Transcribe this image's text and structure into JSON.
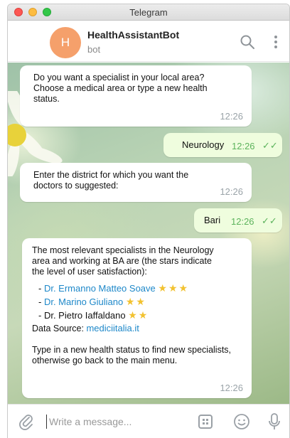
{
  "window": {
    "title": "Telegram"
  },
  "chat": {
    "avatar_letter": "H",
    "name": "HealthAssistantBot",
    "status": "bot"
  },
  "messages": [
    {
      "dir": "in",
      "lines": [
        "Do you want a specialist in your local area?",
        "Choose a medical area or type a new health",
        "status."
      ],
      "time": "12:26"
    },
    {
      "dir": "out",
      "text": "Neurology",
      "time": "12:26",
      "ticks": "✓✓"
    },
    {
      "dir": "in",
      "lines": [
        "Enter the district for which you want the",
        "doctors to suggested:"
      ],
      "time": "12:26"
    },
    {
      "dir": "out",
      "text": "Bari",
      "time": "12:26",
      "ticks": "✓✓"
    },
    {
      "dir": "in",
      "intro": [
        "The most relevant specialists in the Neurology",
        "area and working at BA are (the stars indicate",
        "the level of user satisfaction):"
      ],
      "specialists": [
        {
          "prefix": "- ",
          "name": "Dr. Ermanno Matteo Soave",
          "stars": "★★★"
        },
        {
          "prefix": "- ",
          "name": "Dr. Marino Giuliano",
          "stars": "★★"
        },
        {
          "prefix": "- ",
          "name": "Dr. Pietro Iaffaldano",
          "stars": "★★"
        }
      ],
      "source_label": "Data Source:",
      "source_link": "mediciitalia.it",
      "outro": [
        "Type in a new health status to find new specialists,",
        "otherwise go back to the main menu."
      ],
      "time": "12:26"
    }
  ],
  "composer": {
    "placeholder": "Write a message..."
  },
  "colors": {
    "accent": "#1e88c9",
    "outgoing_bg": "#effdde",
    "check": "#5cb35c",
    "avatar": "#f5a06b"
  },
  "icons": [
    "search-icon",
    "more-vertical-icon",
    "paperclip-icon",
    "bot-commands-icon",
    "emoji-icon",
    "microphone-icon"
  ]
}
